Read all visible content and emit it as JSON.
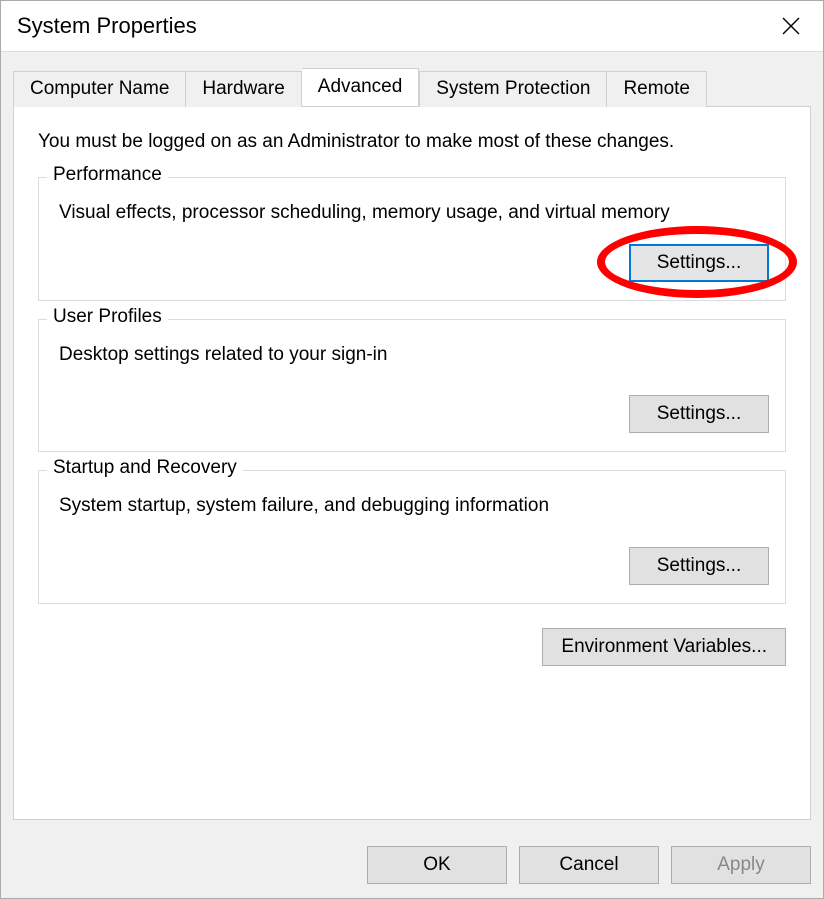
{
  "window": {
    "title": "System Properties"
  },
  "tabs": {
    "computer_name": "Computer Name",
    "hardware": "Hardware",
    "advanced": "Advanced",
    "system_protection": "System Protection",
    "remote": "Remote"
  },
  "panel": {
    "intro": "You must be logged on as an Administrator to make most of these changes.",
    "performance": {
      "legend": "Performance",
      "desc": "Visual effects, processor scheduling, memory usage, and virtual memory",
      "settings_label": "Settings..."
    },
    "user_profiles": {
      "legend": "User Profiles",
      "desc": "Desktop settings related to your sign-in",
      "settings_label": "Settings..."
    },
    "startup_recovery": {
      "legend": "Startup and Recovery",
      "desc": "System startup, system failure, and debugging information",
      "settings_label": "Settings..."
    },
    "env_button": "Environment Variables..."
  },
  "footer": {
    "ok": "OK",
    "cancel": "Cancel",
    "apply": "Apply"
  }
}
